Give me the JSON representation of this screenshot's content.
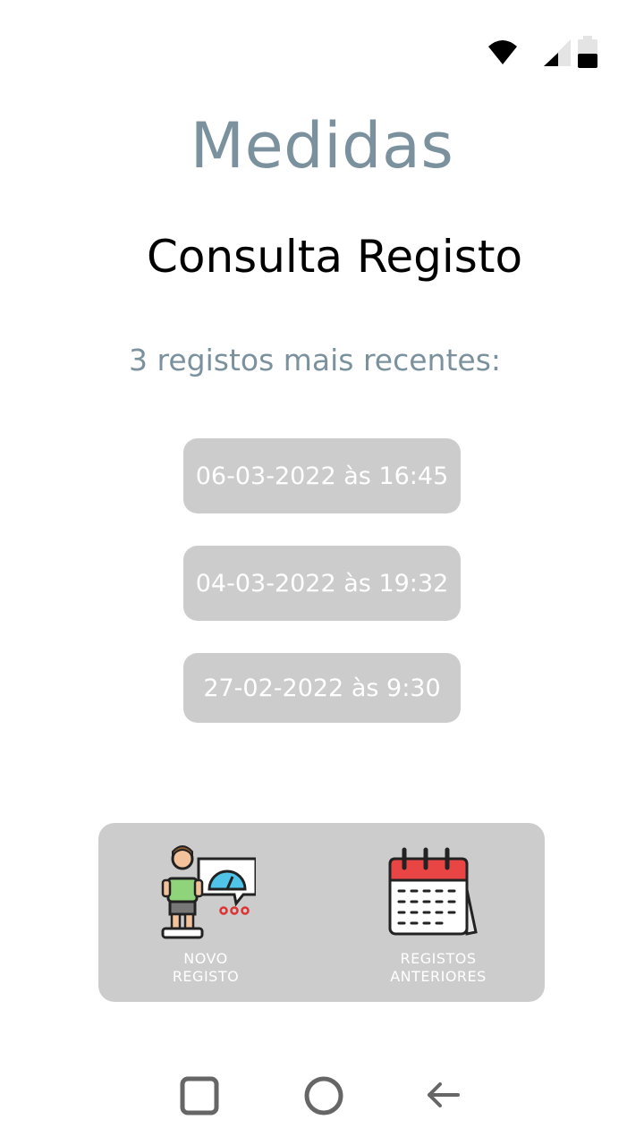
{
  "status_bar": {
    "icons": [
      "wifi-icon",
      "cellular-signal-icon",
      "battery-icon"
    ]
  },
  "app": {
    "title": "Medidas"
  },
  "page": {
    "title": "Consulta Registo",
    "section_label": "3 registos mais recentes:"
  },
  "records": [
    {
      "label": "06-03-2022 às 16:45"
    },
    {
      "label": "04-03-2022 às 19:32"
    },
    {
      "label": "27-02-2022 às 9:30"
    }
  ],
  "bottom_panel": {
    "new_record": {
      "line1": "NOVO",
      "line2": "REGISTO",
      "icon": "person-on-scale-icon"
    },
    "previous_records": {
      "line1": "REGISTOS",
      "line2": "ANTERIORES",
      "icon": "calendar-icon"
    }
  },
  "navigation": {
    "buttons": [
      "recents-square-icon",
      "home-circle-icon",
      "back-arrow-icon"
    ]
  },
  "colors": {
    "accent_text": "#7b929e",
    "button_bg": "#cccccc",
    "button_text": "#ffffff"
  }
}
